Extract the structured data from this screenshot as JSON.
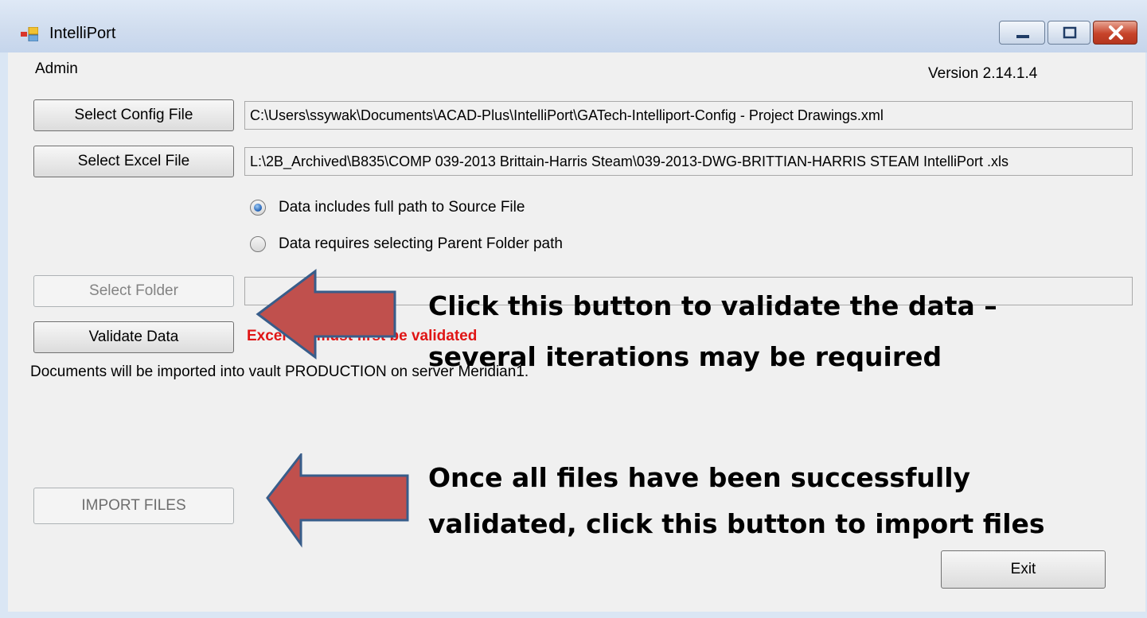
{
  "window": {
    "title": "IntelliPort",
    "controls": {
      "minimize": "minimize",
      "maximize": "maximize",
      "close": "close"
    }
  },
  "menubar": {
    "admin": "Admin",
    "version": "Version 2.14.1.4"
  },
  "config": {
    "button": "Select Config File",
    "path": "C:\\Users\\ssywak\\Documents\\ACAD-Plus\\IntelliPort\\GATech-Intelliport-Config - Project Drawings.xml"
  },
  "excel": {
    "button": "Select Excel File",
    "path": "L:\\2B_Archived\\B835\\COMP 039-2013 Brittain-Harris Steam\\039-2013-DWG-BRITTIAN-HARRIS STEAM IntelliPort .xls"
  },
  "options": {
    "full_path": {
      "label": "Data includes full path to Source File",
      "selected": true
    },
    "parent_folder": {
      "label": "Data requires selecting Parent Folder path",
      "selected": false
    }
  },
  "folder": {
    "button": "Select Folder",
    "path": ""
  },
  "validate": {
    "button": "Validate Data",
    "status": "Excel file must first be validated"
  },
  "info": "Documents will be imported into vault PRODUCTION on server Meridian1.",
  "import": {
    "button": "IMPORT FILES"
  },
  "exit": {
    "button": "Exit"
  },
  "annotations": {
    "validate_line1": "Click this button to validate the data –",
    "validate_line2": "several iterations may be required",
    "import_line1": "Once all files have been successfully",
    "import_line2": "validated, click this button to import files",
    "arrow_color": "#c0504d",
    "arrow_border": "#385d8a"
  }
}
